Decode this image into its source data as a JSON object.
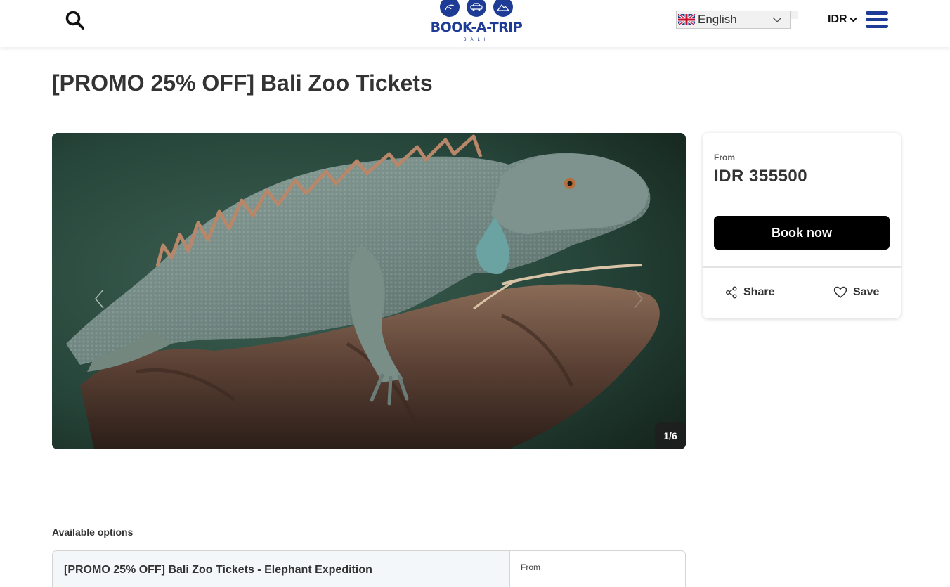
{
  "header": {
    "logo_text": "BOOK-A-TRIP",
    "logo_sub": "BALI",
    "language": "English",
    "currency": "IDR",
    "icons": [
      "search-icon",
      "flag-uk-icon",
      "chevron-down-icon",
      "menu-icon"
    ],
    "brand_color": "#1e3c96"
  },
  "page": {
    "title": "[PROMO 25% OFF] Bali Zoo Tickets"
  },
  "gallery": {
    "counter": "1/6",
    "icons": [
      "chevron-left-icon",
      "chevron-right-icon"
    ]
  },
  "booking": {
    "from_label": "From",
    "price": "IDR 355500",
    "book_label": "Book now",
    "share_label": "Share",
    "save_label": "Save",
    "icons": [
      "share-icon",
      "heart-icon"
    ]
  },
  "options": {
    "heading": "Available options",
    "items": [
      {
        "title": "[PROMO 25% OFF] Bali Zoo Tickets - Elephant Expedition",
        "from_label": "From"
      }
    ]
  }
}
